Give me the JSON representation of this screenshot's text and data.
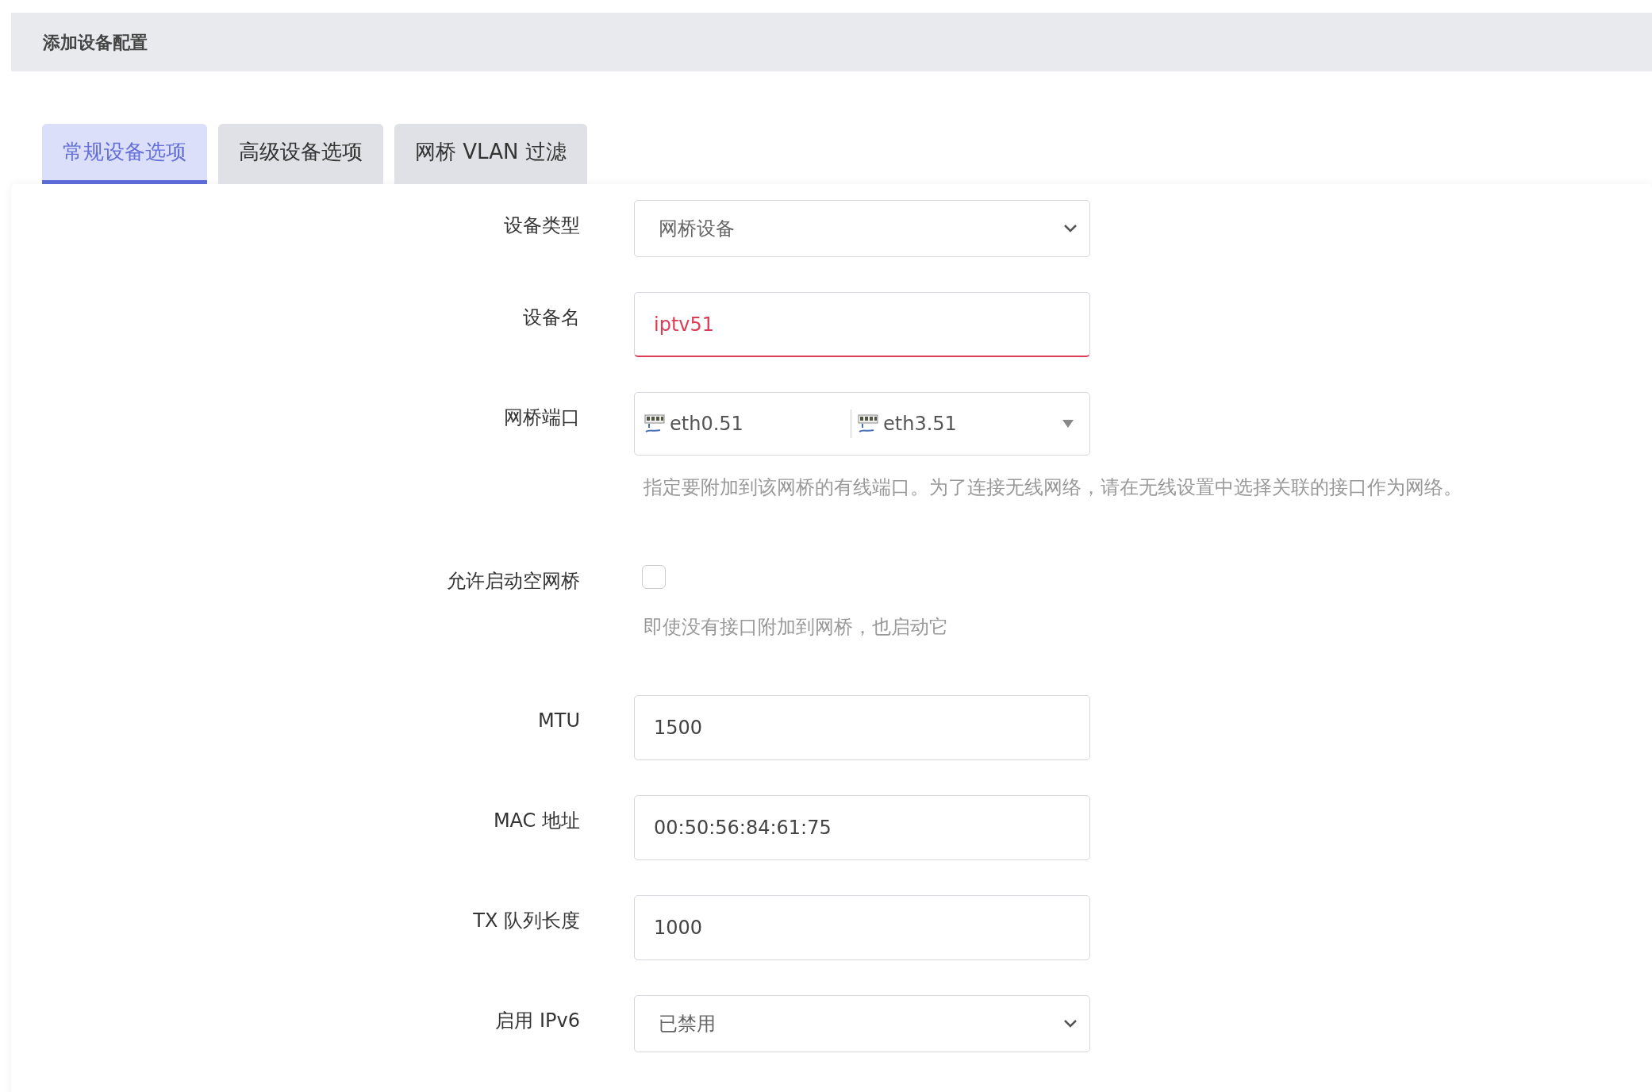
{
  "header": {
    "title": "添加设备配置"
  },
  "tabs": [
    {
      "label": "常规设备选项",
      "selected": true
    },
    {
      "label": "高级设备选项",
      "selected": false
    },
    {
      "label": "网桥 VLAN 过滤",
      "selected": false
    }
  ],
  "fields": [
    {
      "kind": "select",
      "label": "设备类型",
      "value": "网桥设备"
    },
    {
      "kind": "text",
      "label": "设备名",
      "value": "iptv51",
      "invalid": true
    },
    {
      "kind": "multiselect",
      "label": "网桥端口",
      "items": [
        "eth0.51",
        "eth3.51"
      ],
      "hint": "指定要附加到该网桥的有线端口。为了连接无线网络，请在无线设置中选择关联的接口作为网络。"
    },
    {
      "kind": "checkbox",
      "label": "允许启动空网桥",
      "checked": false,
      "hint": "即使没有接口附加到网桥，也启动它"
    },
    {
      "kind": "text",
      "label": "MTU",
      "value": "1500",
      "invalid": false
    },
    {
      "kind": "text",
      "label": "MAC 地址",
      "value": "00:50:56:84:61:75",
      "invalid": false
    },
    {
      "kind": "text",
      "label": "TX 队列长度",
      "value": "1000",
      "invalid": false
    },
    {
      "kind": "select",
      "label": "启用 IPv6",
      "value": "已禁用"
    }
  ]
}
